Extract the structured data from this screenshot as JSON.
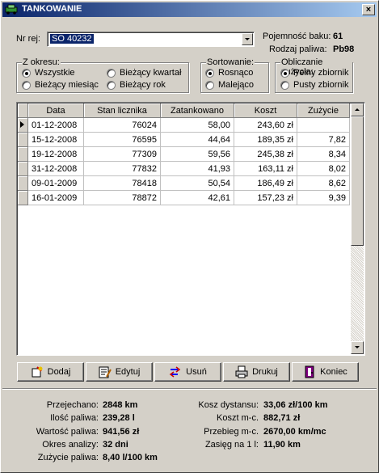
{
  "window": {
    "title": "TANKOWANIE",
    "close": "×"
  },
  "form": {
    "reg_label": "Nr rej:",
    "reg_value": "SO 40232",
    "capacity_label": "Pojemność baku:",
    "capacity_value": "61",
    "fuel_label": "Rodzaj paliwa:",
    "fuel_value": "Pb98"
  },
  "period_group": {
    "title": "Z okresu:",
    "options": [
      "Wszystkie",
      "Bieżący kwartał",
      "Bieżący miesiąc",
      "Bieżący rok"
    ],
    "selected": "Wszystkie"
  },
  "sort_group": {
    "title": "Sortowanie:",
    "options": [
      "Rosnąco",
      "Malejąco"
    ],
    "selected": "Rosnąco"
  },
  "calc_group": {
    "title": "Obliczanie zużycia:",
    "options": [
      "Pełny zbiornik",
      "Pusty zbiornik"
    ],
    "selected": "Pełny zbiornik"
  },
  "table": {
    "headers": [
      "Data",
      "Stan licznika",
      "Zatankowano",
      "Koszt",
      "Zużycie"
    ],
    "rows": [
      [
        "01-12-2008",
        "76024",
        "58,00",
        "243,60 zł",
        ""
      ],
      [
        "15-12-2008",
        "76595",
        "44,64",
        "189,35 zł",
        "7,82"
      ],
      [
        "19-12-2008",
        "77309",
        "59,56",
        "245,38 zł",
        "8,34"
      ],
      [
        "31-12-2008",
        "77832",
        "41,93",
        "163,11 zł",
        "8,02"
      ],
      [
        "09-01-2009",
        "78418",
        "50,54",
        "186,49 zł",
        "8,62"
      ],
      [
        "16-01-2009",
        "78872",
        "42,61",
        "157,23 zł",
        "9,39"
      ]
    ]
  },
  "buttons": {
    "add": "Dodaj",
    "edit": "Edytuj",
    "delete": "Usuń",
    "print": "Drukuj",
    "end": "Koniec"
  },
  "stats": {
    "distance_label": "Przejechano:",
    "distance_value": "2848 km",
    "fuel_amount_label": "Ilość paliwa:",
    "fuel_amount_value": "239,28 l",
    "fuel_value_label": "Wartość paliwa:",
    "fuel_value_value": "941,56 zł",
    "period_label": "Okres analizy:",
    "period_value": "32 dni",
    "consumption_label": "Zużycie paliwa:",
    "consumption_value": "8,40 l/100 km",
    "cost_distance_label": "Kosz dystansu:",
    "cost_distance_value": "33,06 zł/100 km",
    "cost_monthly_label": "Koszt m-c.",
    "cost_monthly_value": "882,71 zł",
    "mileage_monthly_label": "Przebieg m-c.",
    "mileage_monthly_value": "2670,00 km/mc",
    "range_label": "Zasięg na 1 l:",
    "range_value": "11,90 km"
  },
  "colors": {
    "title_start": "#0a246a",
    "title_end": "#a6caf0",
    "face": "#d4d0c8"
  },
  "icons": [
    "car-icon",
    "close-icon",
    "add-icon",
    "edit-icon",
    "delete-icon",
    "print-icon",
    "exit-icon"
  ]
}
